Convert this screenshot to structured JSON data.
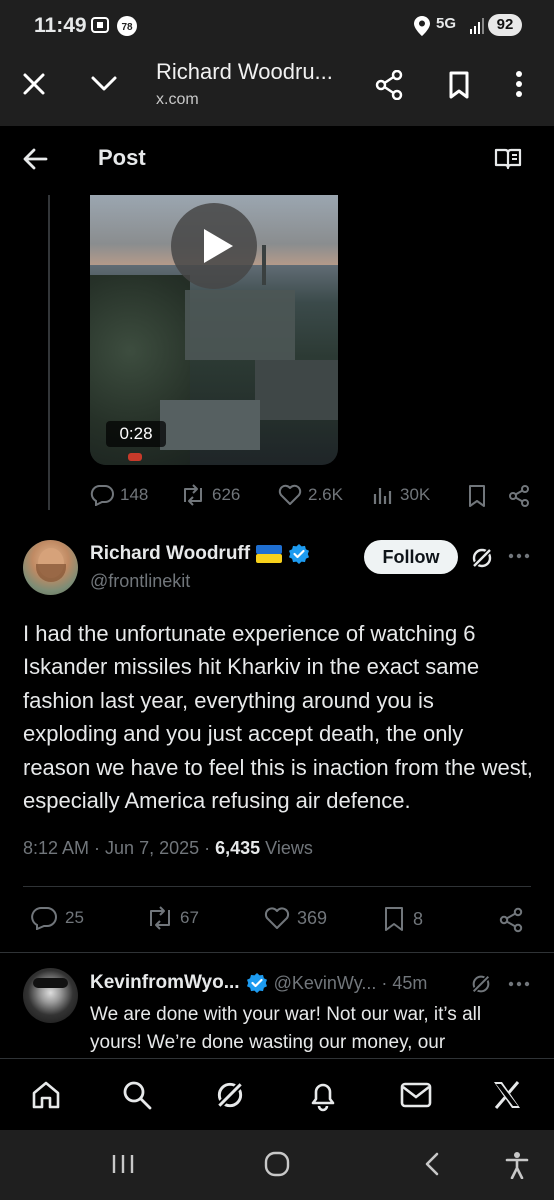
{
  "status_bar": {
    "time": "11:49",
    "network": "5G",
    "battery": "92"
  },
  "browser": {
    "page_title": "Richard Woodru...",
    "domain": "x.com"
  },
  "header": {
    "title": "Post"
  },
  "quoted_video": {
    "duration": "0:28",
    "replies": "148",
    "reposts": "626",
    "likes": "2.6K",
    "views": "30K"
  },
  "post": {
    "author_name": "Richard Woodruff",
    "author_handle": "@frontlinekit",
    "follow_label": "Follow",
    "text": "I had the unfortunate experience of watching 6 Iskander missiles hit Kharkiv in the exact same fashion last year, everything around you is exploding and you just accept death, the only reason we have to feel this is inaction from the west, especially America refusing air defence.",
    "time": "8:12 AM",
    "date": "Jun 7, 2025",
    "views_count": "6,435",
    "views_label": "Views",
    "replies": "25",
    "reposts": "67",
    "likes": "369",
    "bookmarks": "8"
  },
  "reply": {
    "author_name": "KevinfromWyo...",
    "author_handle": "@KevinWy...",
    "age": "45m",
    "text": "We are done with your war! Not our war, it’s all yours! We’re done wasting our money, our"
  },
  "colors": {
    "accent": "#1d9bf0",
    "muted": "#71767b",
    "text": "#e7e9ea",
    "background": "#000000"
  },
  "icons": [
    "close-icon",
    "chevron-down-icon",
    "share-icon",
    "bookmark-icon",
    "more-vertical-icon",
    "back-arrow-icon",
    "reader-icon",
    "play-icon",
    "reply-icon",
    "repost-icon",
    "like-icon",
    "views-icon",
    "grok-icon",
    "more-horizontal-icon",
    "verified-icon",
    "ukraine-flag-icon",
    "home-icon",
    "search-icon",
    "notifications-icon",
    "messages-icon",
    "x-logo-icon",
    "recents-icon",
    "android-home-icon",
    "android-back-icon",
    "accessibility-icon"
  ]
}
